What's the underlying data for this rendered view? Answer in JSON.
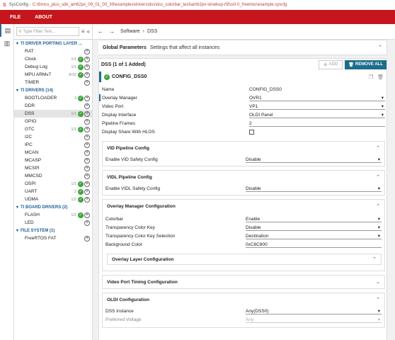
{
  "window": {
    "app_icon": "sysconfig-logo",
    "title_prefix": "SysConfig - ",
    "title_path": "C:\\ti\\mcu_plus_sdk_am62px_09_01_00_39\\examples\\drivers\\dss\\dss_colorbar_test\\am62px-sk\\wkup-r5fss0-0_freertos\\example.syscfg"
  },
  "menu": {
    "file": "FILE",
    "about": "ABOUT"
  },
  "sidebar": {
    "filter_placeholder": "Type Filter Text...",
    "categories": [
      {
        "label": "TI DRIVER PORTING LAYER ...",
        "items": [
          {
            "name": "RAT",
            "count": "",
            "checked": false
          },
          {
            "name": "Clock",
            "count": "1/1",
            "checked": true
          },
          {
            "name": "Debug Log",
            "count": "1/1",
            "checked": true
          },
          {
            "name": "MPU ARMv7",
            "count": "8/16",
            "checked": true
          },
          {
            "name": "TIMER",
            "count": "",
            "checked": false
          }
        ]
      },
      {
        "label": "TI DRIVERS (14)",
        "items": [
          {
            "name": "BOOTLOADER",
            "count": "3",
            "checked": true
          },
          {
            "name": "DDR",
            "count": "",
            "checked": false
          },
          {
            "name": "DSS",
            "count": "1/1",
            "checked": true,
            "selected": true
          },
          {
            "name": "GPIO",
            "count": "",
            "checked": false
          },
          {
            "name": "GTC",
            "count": "1/1",
            "checked": true
          },
          {
            "name": "I2C",
            "count": "",
            "checked": false
          },
          {
            "name": "IPC",
            "count": "",
            "checked": false
          },
          {
            "name": "MCAN",
            "count": "",
            "checked": false
          },
          {
            "name": "MCASP",
            "count": "",
            "checked": false
          },
          {
            "name": "MCSPI",
            "count": "",
            "checked": false
          },
          {
            "name": "MMCSD",
            "count": "",
            "checked": false
          },
          {
            "name": "OSPI",
            "count": "1/1",
            "checked": true
          },
          {
            "name": "UART",
            "count": "2",
            "checked": true
          },
          {
            "name": "UDMA",
            "count": "1/2",
            "checked": true
          }
        ]
      },
      {
        "label": "TI BOARD DRIVERS (2)",
        "items": [
          {
            "name": "FLASH",
            "count": "1/2",
            "checked": true
          },
          {
            "name": "LED",
            "count": "",
            "checked": false
          }
        ]
      },
      {
        "label": "FILE SYSTEM (1)",
        "items": [
          {
            "name": "FreeRTOS FAT",
            "count": "",
            "checked": false
          }
        ]
      }
    ]
  },
  "breadcrumb": {
    "root": "Software",
    "sep": "›",
    "current": "DSS"
  },
  "global_params": {
    "title": "Global Parameters",
    "subtitle": "Settings that affect all instances"
  },
  "module": {
    "header": "DSS (1 of 1 Added)",
    "add_label": "ADD",
    "remove_all_label": "REMOVE ALL",
    "instance_name": "CONFIG_DSS0"
  },
  "fields": {
    "name": {
      "label": "Name",
      "value": "CONFIG_DSS0"
    },
    "overlay_manager": {
      "label": "Overlay Manager",
      "value": "OVR1"
    },
    "video_port": {
      "label": "Video Port",
      "value": "VP1"
    },
    "display_interface": {
      "label": "Display Interface",
      "value": "OLDI Panel"
    },
    "pipeline_frames": {
      "label": "Pipeline Frames",
      "value": "2"
    },
    "display_share": {
      "label": "Display Share With HLOS"
    }
  },
  "vid": {
    "title": "VID Pipeline Config",
    "safety_label": "Enable VID Safety Config",
    "safety_value": "Disable"
  },
  "vidl": {
    "title": "VIDL Pipeline Config",
    "safety_label": "Enable VIDL Safety Config",
    "safety_value": "Disable"
  },
  "overlay": {
    "title": "Overlay Manager Configuration",
    "colorbar": {
      "label": "Colorbar",
      "value": "Enable"
    },
    "tck": {
      "label": "Transparency Color Key",
      "value": "Disable"
    },
    "tcks": {
      "label": "Transparency Color Key Selection",
      "value": "Destination"
    },
    "bg": {
      "label": "Background Color",
      "value": "0xC8C800"
    },
    "layer_title": "Overlay Layer Configuration"
  },
  "vport": {
    "title": "Video Port Timing Configuration"
  },
  "oldi": {
    "title": "OLDI Configuration",
    "instance": {
      "label": "DSS Instance",
      "value": "Any(DSS0)"
    },
    "voltage": {
      "label": "Preferred Voltage",
      "value": "Any"
    }
  },
  "icons": {
    "check": "✓",
    "plus": "+",
    "chevron_up": "⌃",
    "chevron_down": "⌄",
    "select_caret": "▾"
  }
}
